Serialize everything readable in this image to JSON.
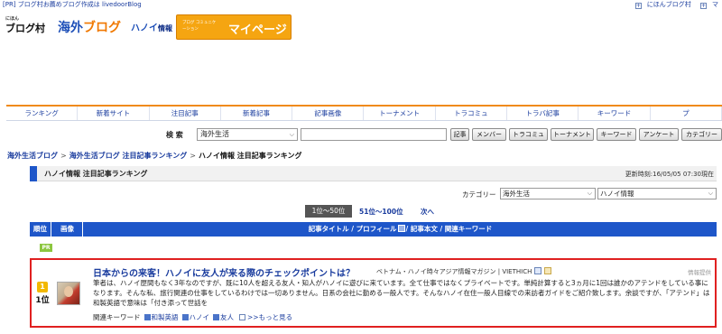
{
  "pr_bar": {
    "left_text": "[PR] ブログ村お薦めブログ作成は livedoorBlog",
    "right_items": [
      "にほんブログ村",
      "マ"
    ]
  },
  "header": {
    "logo_mura": "ブログ村",
    "logo_mura_small": "にほん",
    "logo_kaigai_1": "海外",
    "logo_kaigai_2": "ブログ",
    "logo_hanoi_1": "ハノイ",
    "logo_hanoi_2": "情報",
    "mypage_small": "ブログ コミュニケーション",
    "mypage_big": "マイページ"
  },
  "nav": {
    "tabs": [
      "ランキング",
      "新着サイト",
      "注目記事",
      "新着記事",
      "記事画像",
      "トーナメント",
      "トラコミュ",
      "トラバ記事",
      "キーワード",
      "プ"
    ]
  },
  "search": {
    "label": "検 索",
    "select_value": "海外生活",
    "input_value": "",
    "buttons": [
      "記事",
      "メンバー",
      "トラコミュ",
      "トーナメント",
      "キーワード",
      "アンケート",
      "カテゴリー"
    ]
  },
  "breadcrumb": {
    "items": [
      "海外生活ブログ",
      "海外生活ブログ 注目記事ランキング",
      "ハノイ情報 注目記事ランキング"
    ]
  },
  "heading": {
    "title": "ハノイ情報 注目記事ランキング",
    "updated": "更新時刻:16/05/05 07:30現在"
  },
  "category": {
    "label": "カテゴリー",
    "select1": "海外生活",
    "select2": "ハノイ情報"
  },
  "pagination": {
    "current": "1位〜50位",
    "next_range": "51位〜100位",
    "next": "次へ"
  },
  "table_header": {
    "rank": "順位",
    "image": "画像",
    "columns_a": "記事タイトル / プロフィール",
    "columns_b": "/ 記事本文 / 関連キーワード"
  },
  "pr_badge": "PR",
  "entry": {
    "rank": "1位",
    "medal": "1",
    "title": "日本からの来客！ハノイに友人が来る際のチェックポイントは？",
    "blog": "ベトナム・ハノイ時々アジア情報マガジン | VIETHICH",
    "report": "情報提供",
    "body": "筆者は、ハノイ歴間もなく3年なのですが、既に10人を超える友人・知人がハノイに遊びに来ています。全て仕事ではなくプライベートです。単純計算すると3ヵ月に1回は誰かのアテンドをしている事になります。そんな私、旅行関連の仕事をしているわけでは一切ありません。日系の会社に勤める一般人です。そんなハノイ在住一般人目線での来訪者ガイドをご紹介致します。余談ですが、「アテンド」は和製英語で意味は「付き添って世話を",
    "kw_label": "関連キーワード",
    "keywords": [
      "和製英語",
      "ハノイ",
      "友人"
    ],
    "more": ">>もっと見る"
  },
  "colors": {
    "accent_blue": "#1e56c9",
    "nav_orange": "#f08a1c",
    "mypage_orange": "#f5a511",
    "highlight_red": "#e02020",
    "pr_green": "#8cc63f"
  }
}
